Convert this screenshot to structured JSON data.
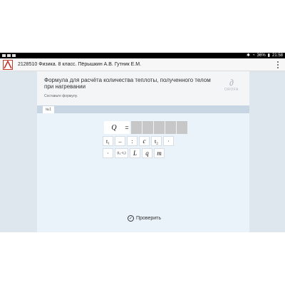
{
  "status": {
    "battery": "36%",
    "time": "21:58"
  },
  "app": {
    "title": "2128510 Физика. 8 класс. Пёрышкин А.В. Гутник Е.М."
  },
  "task": {
    "title": "Формула для расчёта количества теплоты, полученного телом при нагревании",
    "instruction": "Составьте формулу."
  },
  "brand": {
    "name": "DROFA"
  },
  "tabs": [
    {
      "label": "№1"
    }
  ],
  "formula": {
    "lhs": "Q",
    "eq": "="
  },
  "tiles_row1": [
    "t₁",
    "–",
    ":",
    "c",
    "t₂",
    "·"
  ],
  "tiles_row2": [
    "·",
    "(t₂–t₁)",
    "L",
    "q",
    "m"
  ],
  "check_button": {
    "label": "Проверить"
  }
}
